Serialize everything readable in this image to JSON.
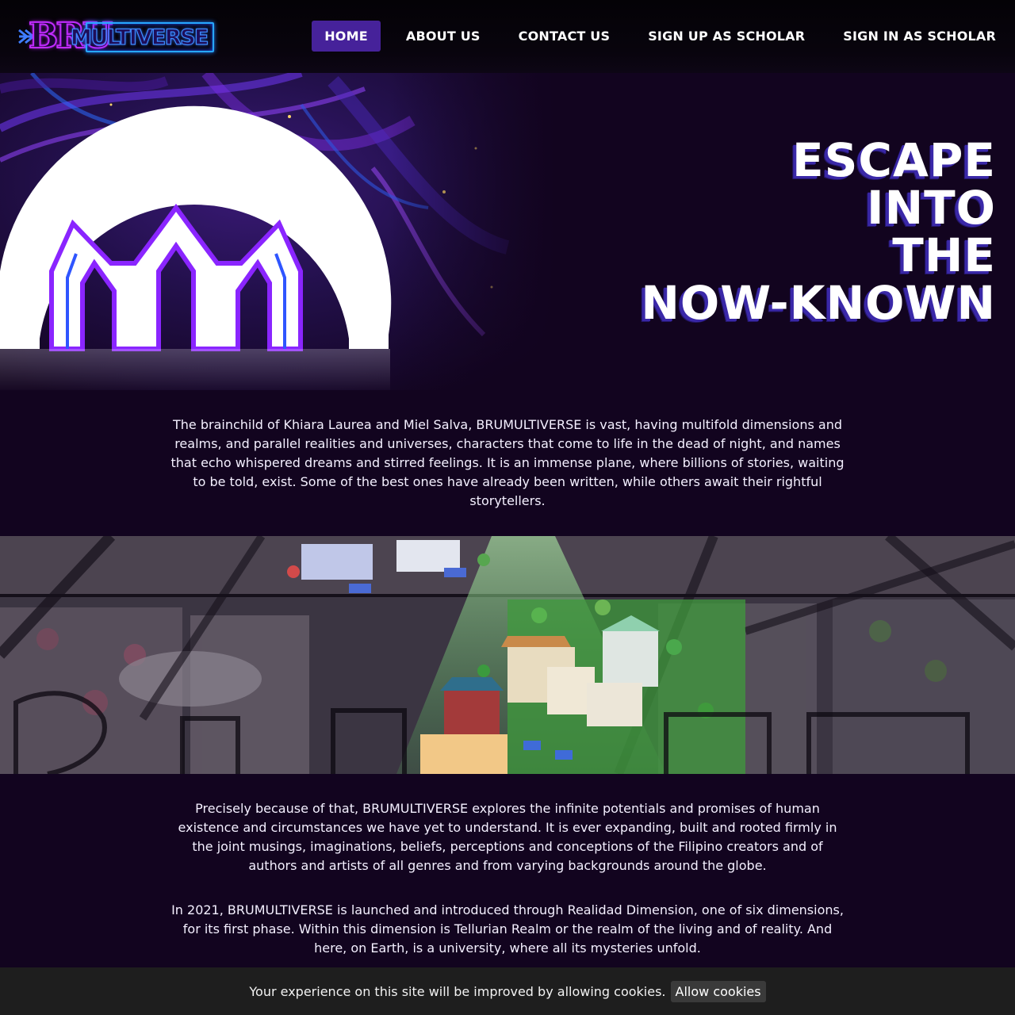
{
  "nav": {
    "logo_bru": "BRU",
    "logo_multiverse": "MULTIVERSE",
    "links": [
      {
        "label": "HOME",
        "active": true
      },
      {
        "label": "ABOUT US",
        "active": false
      },
      {
        "label": "CONTACT US",
        "active": false
      },
      {
        "label": "SIGN UP AS SCHOLAR",
        "active": false
      },
      {
        "label": "SIGN IN AS SCHOLAR",
        "active": false
      }
    ]
  },
  "hero": {
    "title_lines": [
      "ESCAPE",
      "INTO",
      "THE",
      "NOW-KNOWN"
    ],
    "art_icon": "brumultiverse-emblem-icon"
  },
  "intro": {
    "text": "The brainchild of Khiara Laurea and Miel Salva, BRUMULTIVERSE is vast, having multifold dimensions and realms, and parallel realities and universes, characters that come to life in the dead of night, and names that echo whispered dreams and stirred feelings. It is an immense plane, where billions of stories, waiting to be told, exist. Some of the best ones have already been written, while others await their rightful storytellers."
  },
  "banner": {
    "image_icon": "university-city-illustration"
  },
  "lower": {
    "paragraph_1": "Precisely because of that, BRUMULTIVERSE explores the infinite potentials and promises of human existence and circumstances we have yet to understand. It is ever expanding, built and rooted firmly in the joint musings, imaginations, beliefs, perceptions and conceptions of the Filipino creators and of authors and artists of all genres and from varying backgrounds around the globe.",
    "paragraph_2": "In 2021, BRUMULTIVERSE is launched and introduced through Realidad Dimension, one of six dimensions, for its first phase. Within this dimension is Tellurian Realm or the realm of the living and of reality. And here, on Earth, is a university, where all its mysteries unfold."
  },
  "cookie": {
    "message": "Your experience on this site will be improved by allowing cookies.",
    "button_label": "Allow cookies"
  },
  "colors": {
    "background": "#12041f",
    "nav_active": "#46229a",
    "accent_purple": "#c12bff",
    "accent_blue": "#27a7ff"
  }
}
